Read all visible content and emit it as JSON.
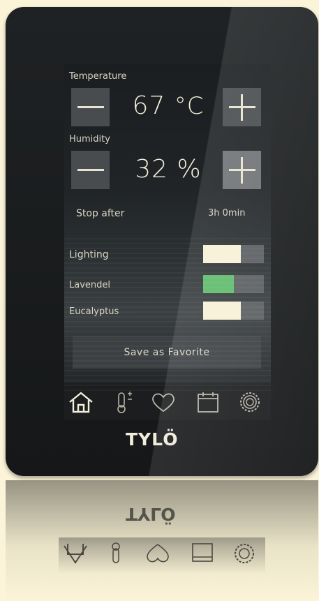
{
  "brand": {
    "logo_text": "TYLÖ"
  },
  "temperature": {
    "label": "Temperature",
    "value": "67",
    "unit": "°C"
  },
  "humidity": {
    "label": "Humidity",
    "value": "32",
    "unit": "%"
  },
  "stop_after": {
    "label": "Stop after",
    "value": "3h 0min"
  },
  "toggles": [
    {
      "label": "Lighting",
      "level": 0.62,
      "color": "#f7f1d6"
    },
    {
      "label": "Lavendel",
      "level": 0.5,
      "color": "#5dbb6a"
    },
    {
      "label": "Eucalyptus",
      "level": 0.62,
      "color": "#f7f1d6"
    }
  ],
  "save_button": {
    "label": "Save as Favorite"
  },
  "nav": {
    "icons": [
      "home-icon",
      "thermometer-icon",
      "heart-icon",
      "calendar-icon",
      "settings-icon"
    ]
  }
}
